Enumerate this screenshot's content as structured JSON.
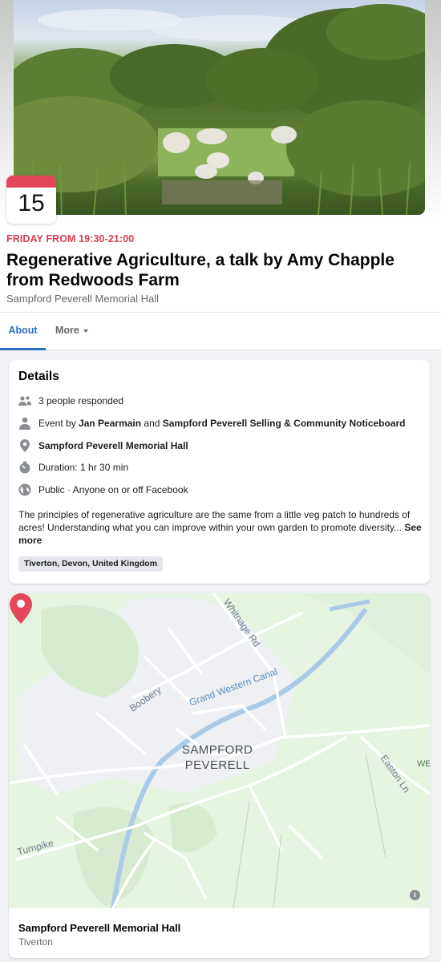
{
  "event": {
    "cover_image": "cows-in-field-photo",
    "date_day": "15",
    "when": "FRIDAY FROM 19:30-21:00",
    "title": "Regenerative Agriculture, a talk by Amy Chapple from Redwoods Farm",
    "venue": "Sampford Peverell Memorial Hall"
  },
  "tabs": [
    {
      "label": "About",
      "active": true
    },
    {
      "label": "More",
      "active": false
    }
  ],
  "details": {
    "heading": "Details",
    "responded": "3 people responded",
    "event_by_prefix": "Event by ",
    "host1": "Jan Pearmain",
    "and": " and ",
    "host2": "Sampford Peverell Selling & Community Noticeboard",
    "location": "Sampford Peverell Memorial Hall",
    "duration": "Duration: 1 hr 30 min",
    "privacy": "Public · Anyone on or off Facebook",
    "description": "The principles of regenerative agriculture are the same from a little veg patch to hundreds of acres! Understanding what you can improve within your own garden to promote diversity...",
    "see_more": "See more",
    "location_chip": "Tiverton, Devon, United Kingdom",
    "icons": [
      "people-icon",
      "person-icon",
      "location-pin-icon",
      "stopwatch-icon",
      "globe-icon"
    ]
  },
  "map": {
    "labels": {
      "whitnage": "Whitnage Rd",
      "canal": "Grand Western Canal",
      "boobery": "Boobery",
      "easton": "Easton Ln",
      "turnpike": "Turnpike",
      "we": "WE",
      "town_line1": "SAMPFORD",
      "town_line2": "PEVERELL"
    },
    "accent_pin": "#e4475a",
    "place_name": "Sampford Peverell Memorial Hall",
    "place_city": "Tiverton"
  }
}
